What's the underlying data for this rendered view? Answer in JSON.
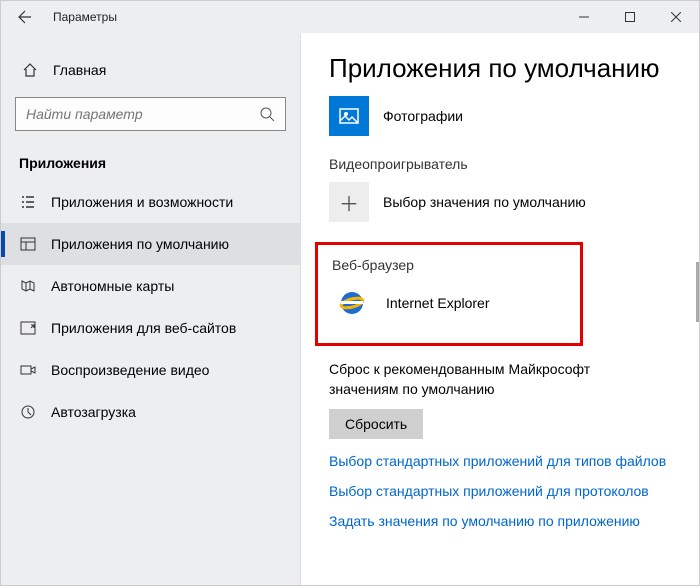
{
  "titlebar": {
    "title": "Параметры"
  },
  "sidebar": {
    "home": "Главная",
    "search_placeholder": "Найти параметр",
    "section": "Приложения",
    "items": [
      {
        "label": "Приложения и возможности"
      },
      {
        "label": "Приложения по умолчанию"
      },
      {
        "label": "Автономные карты"
      },
      {
        "label": "Приложения для веб-сайтов"
      },
      {
        "label": "Воспроизведение видео"
      },
      {
        "label": "Автозагрузка"
      }
    ]
  },
  "main": {
    "heading": "Приложения по умолчанию",
    "photos_app": "Фотографии",
    "video_label": "Видеопроигрыватель",
    "video_choose": "Выбор значения по умолчанию",
    "browser_label": "Веб-браузер",
    "browser_app": "Internet Explorer",
    "reset_text": "Сброс к рекомендованным Майкрософт значениям по умолчанию",
    "reset_btn": "Сбросить",
    "link1": "Выбор стандартных приложений для типов файлов",
    "link2": "Выбор стандартных приложений для протоколов",
    "link3": "Задать значения по умолчанию по приложению"
  }
}
